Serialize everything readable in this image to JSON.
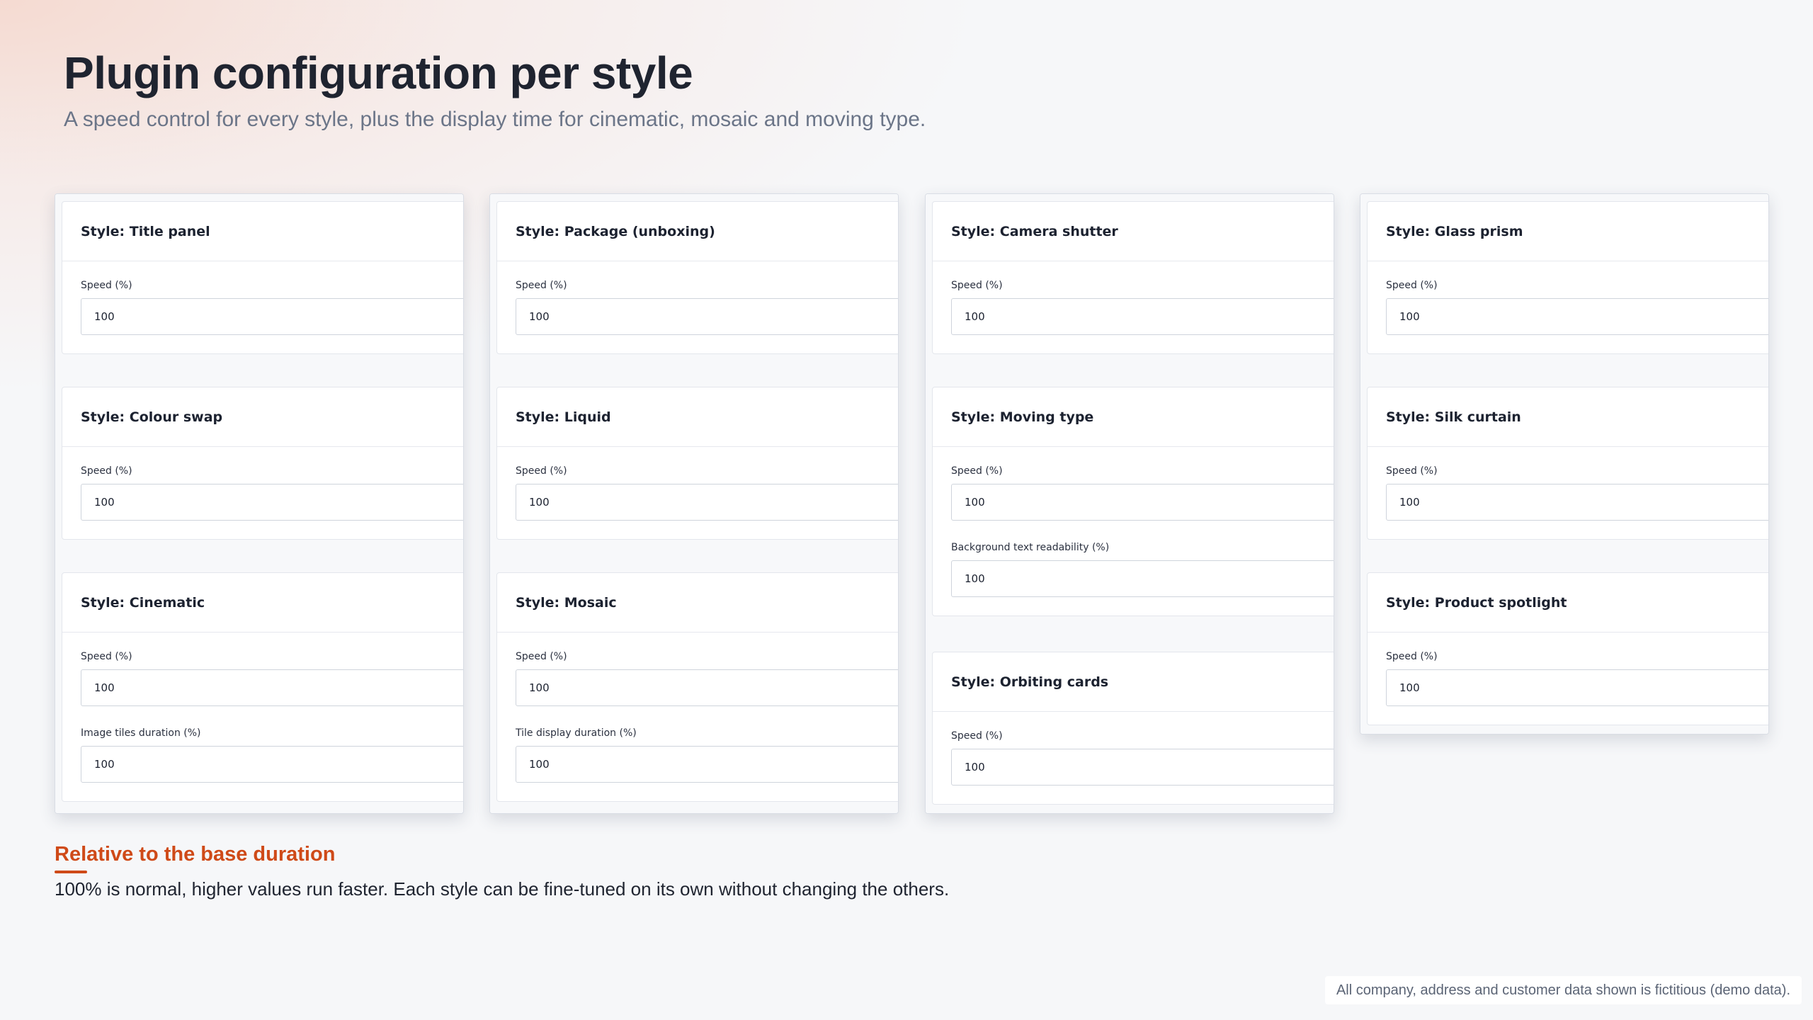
{
  "page": {
    "title": "Plugin configuration per style",
    "subtitle": "A speed control for every style, plus the display time for cinematic, mosaic and moving type."
  },
  "columns": [
    {
      "cards": [
        {
          "title": "Style: Title panel",
          "fields": [
            {
              "label": "Speed (%)",
              "value": "100"
            }
          ]
        },
        {
          "title": "Style: Colour swap",
          "fields": [
            {
              "label": "Speed (%)",
              "value": "100"
            }
          ]
        },
        {
          "title": "Style: Cinematic",
          "fields": [
            {
              "label": "Speed (%)",
              "value": "100"
            },
            {
              "label": "Image tiles duration (%)",
              "value": "100"
            }
          ]
        }
      ]
    },
    {
      "cards": [
        {
          "title": "Style: Package (unboxing)",
          "fields": [
            {
              "label": "Speed (%)",
              "value": "100"
            }
          ]
        },
        {
          "title": "Style: Liquid",
          "fields": [
            {
              "label": "Speed (%)",
              "value": "100"
            }
          ]
        },
        {
          "title": "Style: Mosaic",
          "fields": [
            {
              "label": "Speed (%)",
              "value": "100"
            },
            {
              "label": "Tile display duration (%)",
              "value": "100"
            }
          ]
        }
      ]
    },
    {
      "cards": [
        {
          "title": "Style: Camera shutter",
          "fields": [
            {
              "label": "Speed (%)",
              "value": "100"
            }
          ]
        },
        {
          "title": "Style: Moving type",
          "fields": [
            {
              "label": "Speed (%)",
              "value": "100"
            },
            {
              "label": "Background text readability (%)",
              "value": "100"
            }
          ]
        },
        {
          "title": "Style: Orbiting cards",
          "fields": [
            {
              "label": "Speed (%)",
              "value": "100"
            }
          ]
        }
      ]
    },
    {
      "cards": [
        {
          "title": "Style: Glass prism",
          "fields": [
            {
              "label": "Speed (%)",
              "value": "100"
            }
          ]
        },
        {
          "title": "Style: Silk curtain",
          "fields": [
            {
              "label": "Speed (%)",
              "value": "100"
            }
          ]
        },
        {
          "title": "Style: Product spotlight",
          "fields": [
            {
              "label": "Speed (%)",
              "value": "100"
            }
          ]
        }
      ]
    }
  ],
  "note": {
    "heading": "Relative to the base duration",
    "text": "100% is normal, higher values run faster. Each style can be fine-tuned on its own without changing the others."
  },
  "footer": {
    "disclaimer": "All company, address and customer data shown is fictitious (demo data)."
  },
  "colors": {
    "accent": "#cf4a18",
    "title": "#1f2430",
    "subtitle": "#6b7588"
  }
}
